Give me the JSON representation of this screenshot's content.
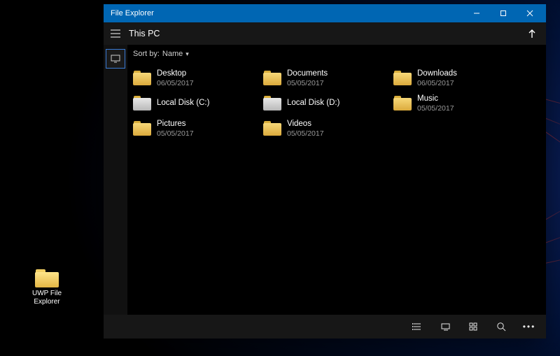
{
  "desktop": {
    "shortcut": {
      "label": "UWP File\nExplorer"
    }
  },
  "window": {
    "title": "File Explorer",
    "location": "This PC",
    "sort": {
      "prefix": "Sort by:",
      "field": "Name"
    },
    "items": [
      {
        "name": "Desktop",
        "date": "06/05/2017",
        "kind": "folder"
      },
      {
        "name": "Documents",
        "date": "05/05/2017",
        "kind": "folder"
      },
      {
        "name": "Downloads",
        "date": "06/05/2017",
        "kind": "folder"
      },
      {
        "name": "Local Disk (C:)",
        "date": "",
        "kind": "drive"
      },
      {
        "name": "Local Disk (D:)",
        "date": "",
        "kind": "drive"
      },
      {
        "name": "Music",
        "date": "05/05/2017",
        "kind": "folder"
      },
      {
        "name": "Pictures",
        "date": "05/05/2017",
        "kind": "folder"
      },
      {
        "name": "Videos",
        "date": "05/05/2017",
        "kind": "folder"
      }
    ],
    "sidebar": {
      "this_pc": "This PC"
    },
    "bottom_actions": {
      "details_view": "Details view",
      "tiles_view": "Tiles view",
      "grid_view": "Grid view",
      "search": "Search",
      "more": "More"
    },
    "window_actions": {
      "minimize": "Minimize",
      "maximize": "Maximize",
      "close": "Close",
      "up": "Up"
    }
  }
}
